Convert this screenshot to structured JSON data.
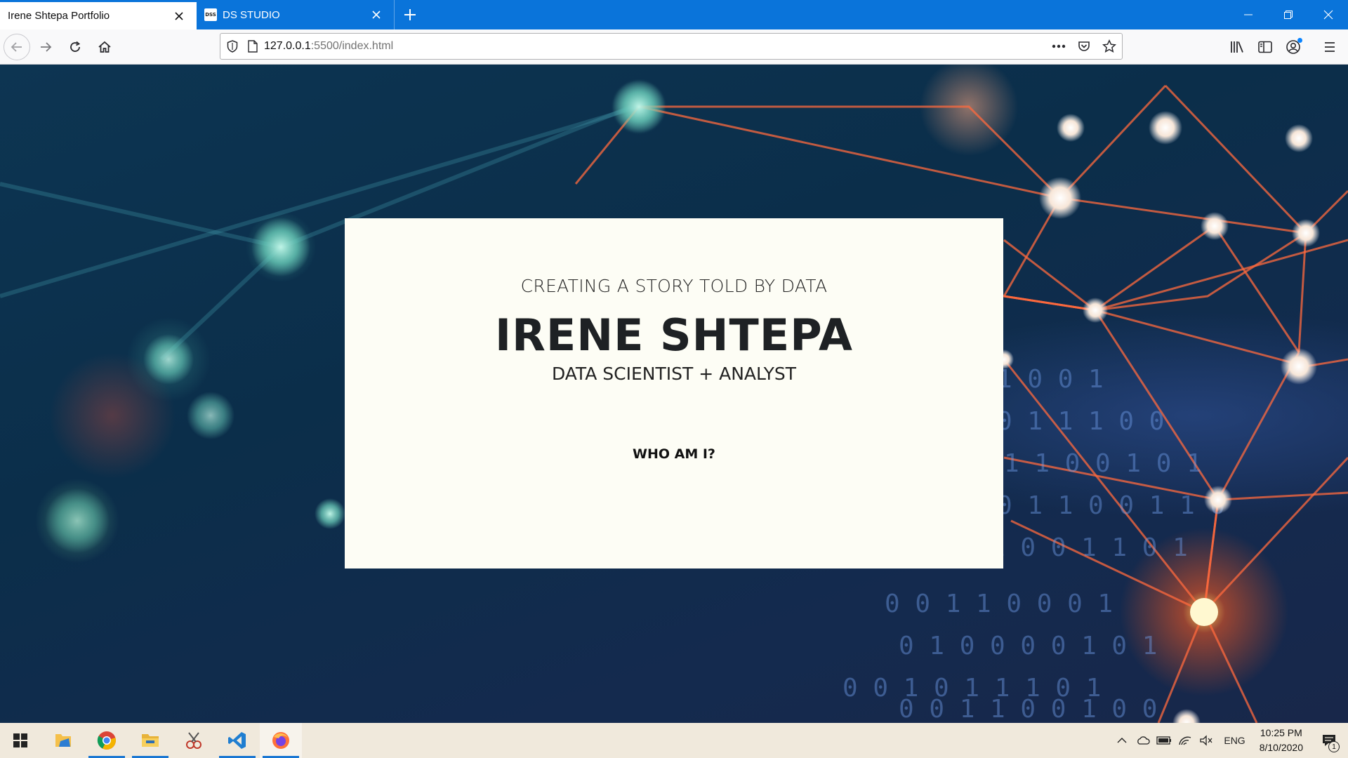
{
  "browser": {
    "tabs": [
      {
        "label": "Irene Shtepa Portfolio",
        "active": true
      },
      {
        "label": "DS STUDIO",
        "active": false,
        "favicon_text": "DSS"
      }
    ],
    "url": {
      "host": "127.0.0.1",
      "path": ":5500/index.html"
    },
    "accent_color": "#0a74da"
  },
  "hero": {
    "tagline": "CREATING A STORY TOLD BY DATA",
    "name": "IRENE SHTEPA",
    "role": "DATA SCIENTIST + ANALYST",
    "link_label": "WHO AM I?",
    "background_color": "#fdfdf5"
  },
  "taskbar": {
    "apps": [
      "windows-start-icon",
      "file-manager-icon",
      "chrome-icon",
      "file-explorer-icon",
      "snipping-tool-icon",
      "vscode-icon",
      "firefox-icon"
    ],
    "language": "ENG",
    "time": "10:25 PM",
    "date": "8/10/2020",
    "notification_count": "1"
  }
}
